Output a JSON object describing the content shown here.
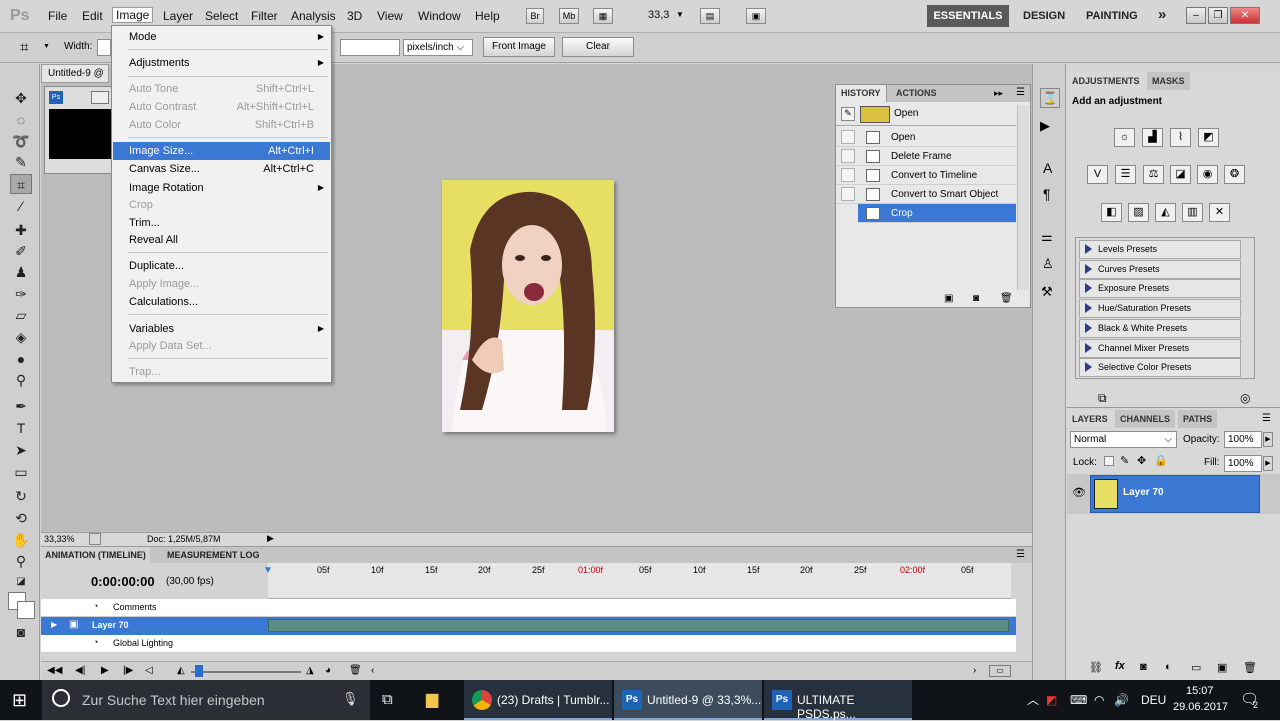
{
  "app": {
    "logo": "Ps",
    "menus": [
      "File",
      "Edit",
      "Image",
      "Layer",
      "Select",
      "Filter",
      "Analysis",
      "3D",
      "View",
      "Window",
      "Help"
    ],
    "active_menu": "Image",
    "bridge_btn": "Br",
    "minibridge_btn": "Mb",
    "zoom": "33,3",
    "workspaces": {
      "essentials": "ESSENTIALS",
      "design": "DESIGN",
      "painting": "PAINTING",
      "more": "»"
    }
  },
  "options": {
    "width_label": "Width:",
    "units": "pixels/inch",
    "front_image": "Front Image",
    "clear": "Clear"
  },
  "document": {
    "tab_title": "Untitled-9 @",
    "zoom": "33,33%",
    "doc_size": "Doc: 1,25M/5,87M"
  },
  "image_menu": {
    "items": [
      {
        "label": "Mode",
        "shortcut": "",
        "submenu": true,
        "disabled": false
      },
      {
        "label": "Adjustments",
        "shortcut": "",
        "submenu": true,
        "disabled": false
      },
      {
        "label": "Auto Tone",
        "shortcut": "Shift+Ctrl+L",
        "disabled": true
      },
      {
        "label": "Auto Contrast",
        "shortcut": "Alt+Shift+Ctrl+L",
        "disabled": true
      },
      {
        "label": "Auto Color",
        "shortcut": "Shift+Ctrl+B",
        "disabled": true
      },
      {
        "label": "Image Size...",
        "shortcut": "Alt+Ctrl+I",
        "highlighted": true
      },
      {
        "label": "Canvas Size...",
        "shortcut": "Alt+Ctrl+C"
      },
      {
        "label": "Image Rotation",
        "shortcut": "",
        "submenu": true
      },
      {
        "label": "Crop",
        "shortcut": "",
        "disabled": true
      },
      {
        "label": "Trim...",
        "shortcut": ""
      },
      {
        "label": "Reveal All",
        "shortcut": ""
      },
      {
        "label": "Duplicate...",
        "shortcut": ""
      },
      {
        "label": "Apply Image...",
        "shortcut": "",
        "disabled": true
      },
      {
        "label": "Calculations...",
        "shortcut": ""
      },
      {
        "label": "Variables",
        "shortcut": "",
        "submenu": true
      },
      {
        "label": "Apply Data Set...",
        "shortcut": "",
        "disabled": true
      },
      {
        "label": "Trap...",
        "shortcut": "",
        "disabled": true
      }
    ]
  },
  "history": {
    "tabs": [
      "HISTORY",
      "ACTIONS"
    ],
    "snapshot": "Open",
    "steps": [
      "Open",
      "Delete Frame",
      "Convert to Timeline",
      "Convert to Smart Object",
      "Crop"
    ],
    "active_step": "Crop"
  },
  "adjustments": {
    "tabs": [
      "ADJUSTMENTS",
      "MASKS"
    ],
    "heading": "Add an adjustment",
    "presets": [
      "Levels Presets",
      "Curves Presets",
      "Exposure Presets",
      "Hue/Saturation Presets",
      "Black & White Presets",
      "Channel Mixer Presets",
      "Selective Color Presets"
    ]
  },
  "layers": {
    "tabs": [
      "LAYERS",
      "CHANNELS",
      "PATHS"
    ],
    "blend_mode": "Normal",
    "opacity_label": "Opacity:",
    "opacity": "100%",
    "lock_label": "Lock:",
    "fill_label": "Fill:",
    "fill": "100%",
    "layer_name": "Layer 70"
  },
  "animation": {
    "tabs": [
      "ANIMATION (TIMELINE)",
      "MEASUREMENT LOG"
    ],
    "timecode": "0:00:00:00",
    "fps": "(30,00 fps)",
    "ticks": [
      "05f",
      "10f",
      "15f",
      "20f",
      "25f",
      "01:00f",
      "05f",
      "10f",
      "15f",
      "20f",
      "25f",
      "02:00f",
      "05f"
    ],
    "tracks": [
      "Comments",
      "Layer 70",
      "Global Lighting"
    ]
  },
  "taskbar": {
    "search_placeholder": "Zur Suche Text hier eingeben",
    "apps": [
      "(23) Drafts | Tumblr...",
      "Untitled-9 @ 33,3%...",
      "ULTIMATE PSDS.ps..."
    ],
    "lang": "DEU",
    "time": "15:07",
    "date": "29.06.2017",
    "notif_count": "2"
  },
  "colors": {
    "accent": "#3a78d4",
    "timeline_red": "#c00000"
  }
}
